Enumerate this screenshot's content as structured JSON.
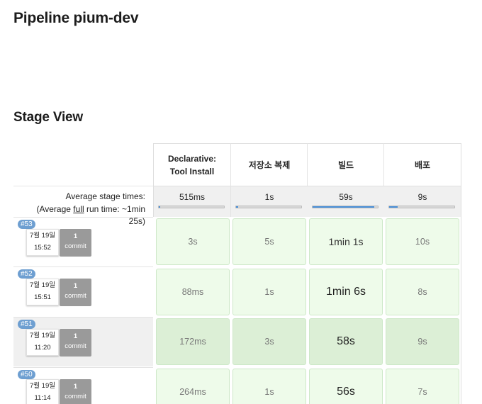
{
  "page_title": "Pipeline pium-dev",
  "section_title": "Stage View",
  "stages": [
    {
      "name_lines": [
        "Declarative:",
        "Tool Install"
      ],
      "avg": "515ms",
      "avg_fraction": 0.02
    },
    {
      "name_lines": [
        "저장소 복제"
      ],
      "avg": "1s",
      "avg_fraction": 0.03
    },
    {
      "name_lines": [
        "빌드"
      ],
      "avg": "59s",
      "avg_fraction": 0.95
    },
    {
      "name_lines": [
        "배포"
      ],
      "avg": "9s",
      "avg_fraction": 0.13
    }
  ],
  "avg_label": {
    "line1": "Average stage times:",
    "line2_prefix": "(Average ",
    "line2_link": "full",
    "line2_suffix": " run time: ~1min",
    "line3": "25s)"
  },
  "builds": [
    {
      "number": "#53",
      "date": "7월 19일",
      "time": "15:52",
      "commit_count": "1",
      "commit_label": "commit",
      "durations": [
        "3s",
        "5s",
        "1min 1s",
        "10s"
      ]
    },
    {
      "number": "#52",
      "date": "7월 19일",
      "time": "15:51",
      "commit_count": "1",
      "commit_label": "commit",
      "durations": [
        "88ms",
        "1s",
        "1min 6s",
        "8s"
      ]
    },
    {
      "number": "#51",
      "date": "7월 19일",
      "time": "11:20",
      "commit_count": "1",
      "commit_label": "commit",
      "durations": [
        "172ms",
        "3s",
        "58s",
        "9s"
      ]
    },
    {
      "number": "#50",
      "date": "7월 19일",
      "time": "11:14",
      "commit_count": "1",
      "commit_label": "commit",
      "durations": [
        "264ms",
        "1s",
        "56s",
        "7s"
      ]
    }
  ],
  "colors": {
    "stage_success": "#eefbea",
    "progress_fill": "#4a90d9",
    "build_badge": "#6e9fd1",
    "commit_box": "#9a9a9a"
  }
}
